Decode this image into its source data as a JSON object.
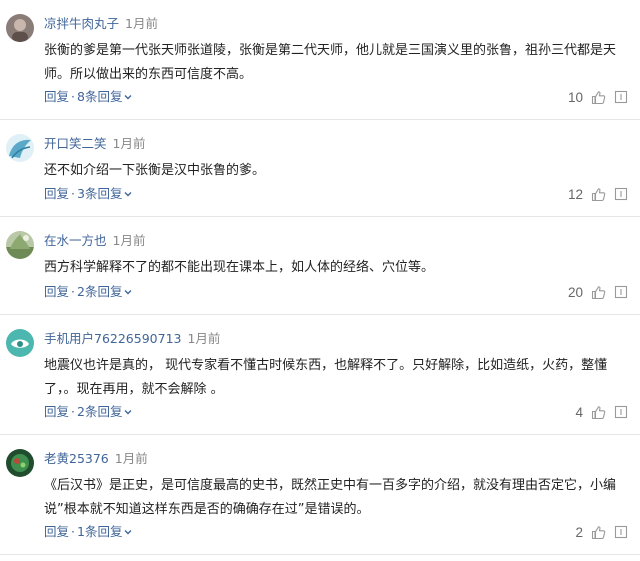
{
  "comments": [
    {
      "username": "凉拌牛肉丸子",
      "time": "1月前",
      "text": "张衡的爹是第一代张天师张道陵，张衡是第二代天师，他儿就是三国演义里的张鲁，祖孙三代都是天师。所以做出来的东西可信度不高。",
      "reply_label": "回复",
      "separator": "·",
      "replies_label": "8条回复",
      "likes": "10"
    },
    {
      "username": "开口笑二笑",
      "time": "1月前",
      "text": "还不如介绍一下张衡是汉中张鲁的爹。",
      "reply_label": "回复",
      "separator": "·",
      "replies_label": "3条回复",
      "likes": "12"
    },
    {
      "username": "在水一方也",
      "time": "1月前",
      "text": "西方科学解释不了的都不能出现在课本上，如人体的经络、穴位等。",
      "reply_label": "回复",
      "separator": "·",
      "replies_label": "2条回复",
      "likes": "20"
    },
    {
      "username": "手机用户76226590713",
      "time": "1月前",
      "text": "地震仪也许是真的， 现代专家看不懂古时候东西，也解释不了。只好解除，比如造纸，火药，整懂了，。现在再用，就不会解除 。",
      "reply_label": "回复",
      "separator": "·",
      "replies_label": "2条回复",
      "likes": "4"
    },
    {
      "username": "老黄25376",
      "time": "1月前",
      "text": "《后汉书》是正史，是可信度最高的史书，既然正史中有一百多字的介绍，就没有理由否定它，小编说”根本就不知道这样东西是否的确确存在过”是错误的。",
      "reply_label": "回复",
      "separator": "·",
      "replies_label": "1条回复",
      "likes": "2"
    }
  ],
  "colors": {
    "link": "#406599",
    "text": "#222222",
    "muted": "#888888",
    "divider": "#e6e6e6"
  },
  "icons": [
    "avatar",
    "chevron-down-icon",
    "thumbs-up-icon",
    "report-icon"
  ]
}
